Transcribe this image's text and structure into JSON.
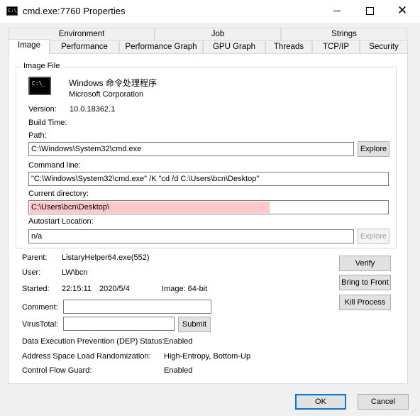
{
  "window": {
    "title": "cmd.exe:7760 Properties",
    "icon": "console-icon"
  },
  "tabs_back": [
    "Environment",
    "Job",
    "Strings"
  ],
  "tabs_front": [
    "Image",
    "Performance",
    "Performance Graph",
    "GPU Graph",
    "Threads",
    "TCP/IP",
    "Security"
  ],
  "image_file": {
    "group_label": "Image File",
    "description": "Windows 命令处理程序",
    "company": "Microsoft Corporation",
    "version_label": "Version:",
    "version": "10.0.18362.1",
    "build_time_label": "Build Time:",
    "path_label": "Path:",
    "path": "C:\\Windows\\System32\\cmd.exe",
    "explore_label": "Explore",
    "command_line_label": "Command line:",
    "command_line": "\"C:\\Windows\\System32\\cmd.exe\" /K \"cd /d C:\\Users\\bcn\\Desktop\"",
    "current_directory_label": "Current directory:",
    "current_directory": "C:\\Users\\bcn\\Desktop\\",
    "autostart_label": "Autostart Location:",
    "autostart": "n/a",
    "explore2_label": "Explore"
  },
  "process": {
    "parent_label": "Parent:",
    "parent": "ListaryHelper64.exe(552)",
    "user_label": "User:",
    "user": "LW\\bcn",
    "started_label": "Started:",
    "started_time": "22:15:11",
    "started_date": "2020/5/4",
    "image_label": "Image: 64-bit",
    "comment_label": "Comment:",
    "comment": "",
    "virustotal_label": "VirusTotal:",
    "virustotal": "",
    "submit_label": "Submit",
    "dep_label": "Data Execution Prevention (DEP) Status:",
    "dep": "Enabled",
    "aslr_label": "Address Space Load Randomization:",
    "aslr": "High-Entropy, Bottom-Up",
    "cfg_label": "Control Flow Guard:",
    "cfg": "Enabled"
  },
  "actions": {
    "verify": "Verify",
    "bring_to_front": "Bring to Front",
    "kill_process": "Kill Process"
  },
  "footer": {
    "ok": "OK",
    "cancel": "Cancel"
  }
}
